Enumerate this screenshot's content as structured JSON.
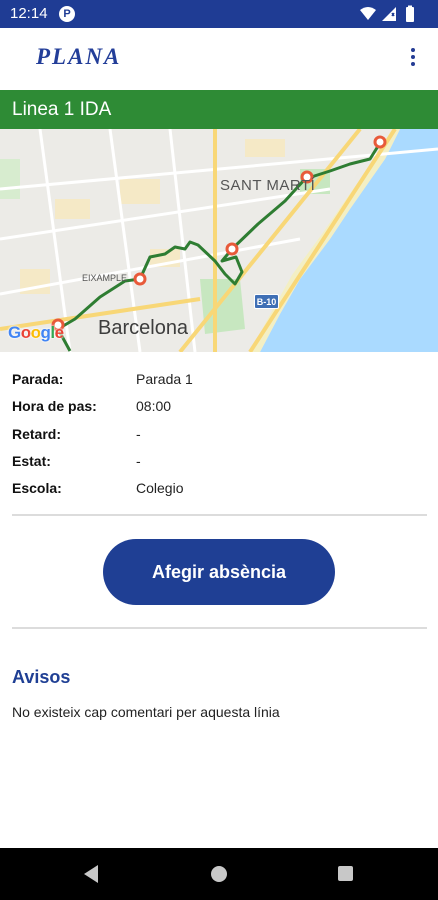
{
  "status_bar": {
    "time": "12:14",
    "app_icon": "P",
    "icons": [
      "wifi-icon",
      "signal-icon",
      "battery-icon"
    ]
  },
  "app_bar": {
    "logo_text": "PLANA",
    "menu_icon": "overflow-menu-icon"
  },
  "line": {
    "title": "Linea 1 IDA",
    "color": "#2e8b35"
  },
  "map": {
    "labels": {
      "district_1": "SANT MARTÍ",
      "district_2": "EIXAMPLE",
      "city": "Barcelona",
      "road": "B-10"
    },
    "attribution": "Google",
    "route_color": "#2e7d32",
    "stop_marker_color": "#e85a3a",
    "stop_count": 5
  },
  "info": {
    "rows": [
      {
        "label": "Parada:",
        "value": "Parada 1"
      },
      {
        "label": "Hora de pas:",
        "value": "08:00"
      },
      {
        "label": "Retard:",
        "value": "-"
      },
      {
        "label": "Estat:",
        "value": "-"
      },
      {
        "label": "Escola:",
        "value": "Colegio"
      }
    ]
  },
  "actions": {
    "absence_button": "Afegir absència"
  },
  "notices": {
    "title": "Avisos",
    "empty_text": "No existeix cap comentari per aquesta línia"
  },
  "colors": {
    "primary": "#1f3f94",
    "status_bar": "#1f3c94"
  }
}
